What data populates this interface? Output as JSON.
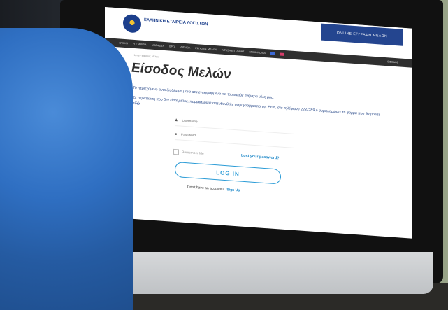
{
  "site": {
    "brand": "ΕΛΛΗΝΙΚΗ ΕΤΑΙΡΕΙΑ ΛΟΓΙΣΤΩΝ",
    "cta": "ONLINE ΕΓΓΡΑΦΗ ΜΕΛΩΝ"
  },
  "nav": {
    "items": [
      "ΑΡΧΙΚΗ",
      "Η ΕΤΑΙΡΕΙΑ",
      "ΜΟΡΦΩΣΗ",
      "ΕΡΓΑ",
      "ΔΙΕΝΕΙΑ",
      "ΕΡΓΑΣΙΕΣ ΜΕΛΩΝ",
      "ΑΙΤΗΣΗ ΕΓΓΡΑΦΗΣ",
      "ΕΠΙΚΟΙΝΩΝΙΑ"
    ],
    "login": "ΕΙΣΟΔΟΣ"
  },
  "breadcrumb": "Home  /  Είσοδος Μελών",
  "page": {
    "title": "Είσοδος Μελών",
    "desc1": "Το περιεχόμενο είναι διαθέσιμο μόνο στα εγγεγραμμένα και ταμειακώς ενήμερα μέλη μας.",
    "desc2": "Σε περίπτωση που δεν είστε μέλος, παρακαλούμε απευθυνθείτε στην γραμματεία της ΕΕΛ, στο τηλέφωνο 2287289 ή συμπληρώστε τη φόρμα που θα βρείτε ",
    "desc2_link": "εδώ"
  },
  "form": {
    "username_placeholder": "Username",
    "password_placeholder": "Password",
    "remember": "Remember Me",
    "lost_password": "Lost your password?",
    "login_button": "LOG IN",
    "no_account": "Don't have an account?",
    "signup": "Sign Up"
  }
}
